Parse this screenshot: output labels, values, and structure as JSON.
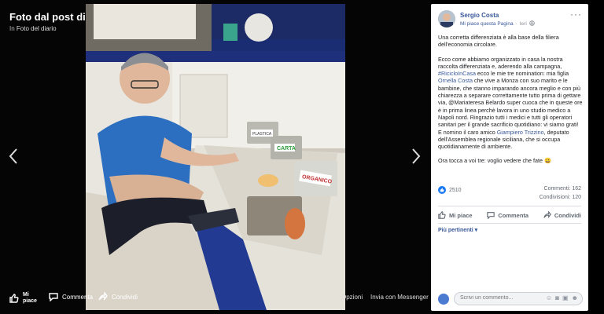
{
  "viewer": {
    "title": "Foto dal post di Sergio Costa",
    "subtitle_prefix": "In",
    "subtitle_link": "Foto del diario",
    "prev_icon": "chevron-left-icon",
    "next_icon": "chevron-right-icon",
    "actions": {
      "like": "Mi piace",
      "comment": "Commenta",
      "share": "Condividi",
      "options": "Opzioni",
      "messenger": "Invia con Messenger"
    },
    "photo_signs": {
      "paper": "CARTA",
      "organic": "ORGANICO",
      "plastic": "PLASTICA"
    }
  },
  "post": {
    "author": "Sergio Costa",
    "like_page": "Mi piace questa Pagina",
    "time": "Ieri",
    "para1": "Una corretta differenziata è alla base della filiera dell'economia circolare.",
    "para2_a": "Ecco come abbiamo organizzato in casa la nostra raccolta differenziata e, aderendo alla campagna, ",
    "para2_hashtag": "#RicicloInCasa",
    "para2_b": " ecco le mie tre nomination: mia figlia ",
    "para2_mention": "Ornella Costa",
    "para2_c": " che vive a Monza con suo marito e le bambine, che stanno imparando ancora meglio e con più chiarezza a separare correttamente tutto prima di gettare via, @Mariateresa Belardo super cuoca che in queste ore è in prima linea perchè lavora in uno studio medico a Napoli nord. Ringrazio tutti i medici e tutti gli operatori sanitari per il grande sacrificio quotidiano: vi siamo grati!",
    "para2_d": "E nomino il caro amico ",
    "para2_mention2": "Giampiero Trizzino",
    "para2_e": ", deputato dell'Assemblea regionale siciliana, che si occupa quotidianamente di ambiente.",
    "para3": "Ora tocca a voi tre: voglio vedere che fate 😀",
    "reactions": "2510",
    "comments": "Commenti: 162",
    "shares": "Condivisioni: 120",
    "btn_like": "Mi piace",
    "btn_comment": "Commenta",
    "btn_share": "Condividi",
    "sort": "Più pertinenti ▾",
    "comment_placeholder": "Scrivi un commento..."
  },
  "colors": {
    "link": "#385898",
    "reaction_like": "#1877f2"
  }
}
